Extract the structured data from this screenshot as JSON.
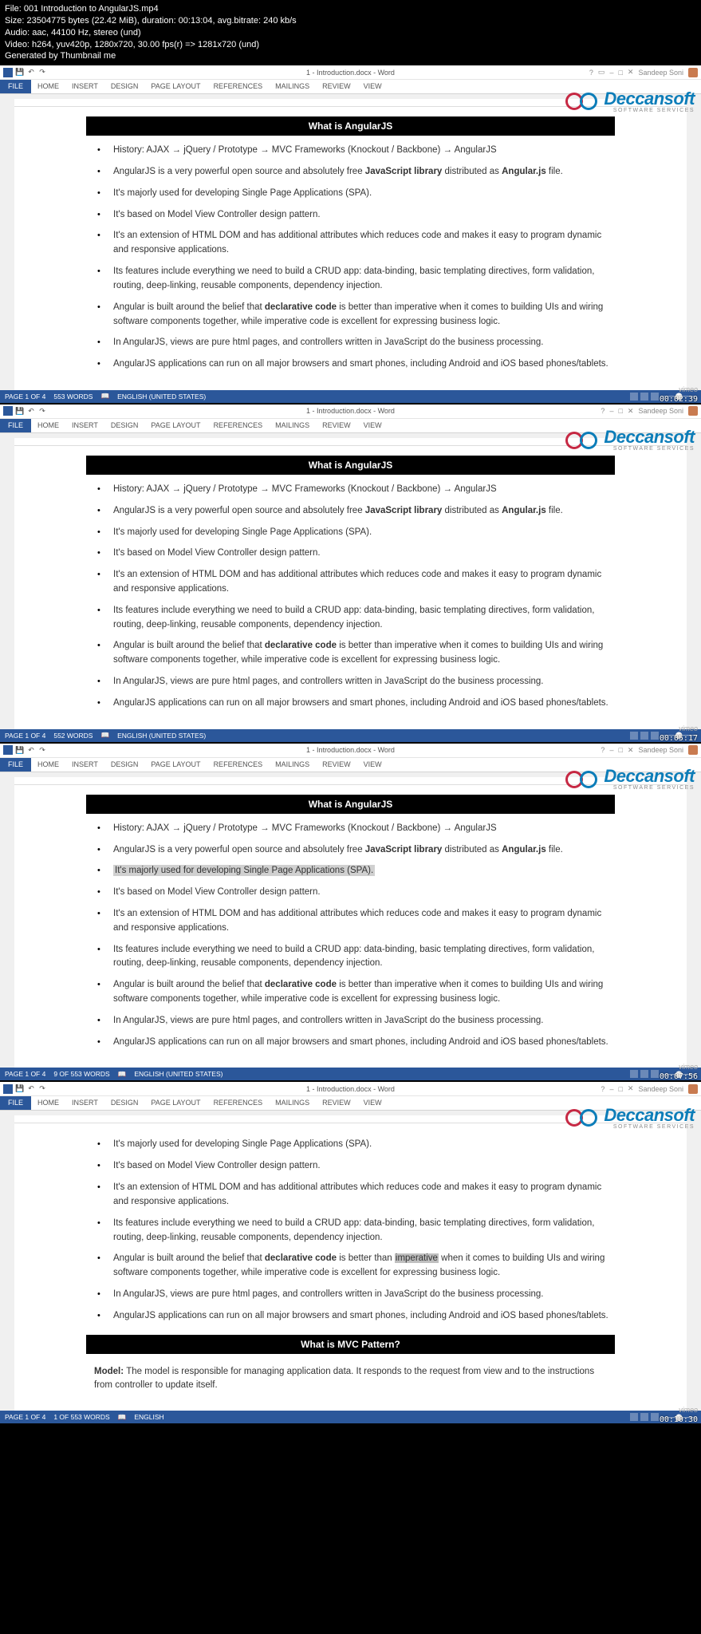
{
  "file_info": {
    "line1": "File: 001 Introduction to AngularJS.mp4",
    "line2": "Size: 23504775 bytes (22.42 MiB), duration: 00:13:04, avg.bitrate: 240 kb/s",
    "line3": "Audio: aac, 44100 Hz, stereo (und)",
    "line4": "Video: h264, yuv420p, 1280x720, 30.00 fps(r) => 1281x720 (und)",
    "line5": "Generated by Thumbnail me"
  },
  "word": {
    "title": "1 - Introduction.docx - Word",
    "user": "Sandeep Soni",
    "file_tab": "FILE",
    "tabs": [
      "HOME",
      "INSERT",
      "DESIGN",
      "PAGE LAYOUT",
      "REFERENCES",
      "MAILINGS",
      "REVIEW",
      "VIEW"
    ]
  },
  "watermark": {
    "main": "Deccansoft",
    "sub": "SOFTWARE SERVICES"
  },
  "content": {
    "heading1": "What is AngularJS",
    "heading2": "What is MVC Pattern?",
    "bullets": [
      {
        "pre": "History: AJAX ",
        "p2": " jQuery / Prototype ",
        "p3": " MVC Frameworks (Knockout / Backbone) ",
        "p4": " AngularJS"
      },
      {
        "pre": "AngularJS is a very powerful open source and absolutely free ",
        "b1": "JavaScript library",
        "mid": " distributed as ",
        "b2": "Angular.js",
        "post": " file."
      },
      {
        "text": "It's majorly used for developing Single Page Applications (SPA)."
      },
      {
        "text": "It's based on Model View Controller design pattern."
      },
      {
        "text": "It's an extension of HTML DOM and has additional attributes which reduces code and makes it easy to program dynamic and responsive applications."
      },
      {
        "text": "Its features include everything we need to build a CRUD app: data-binding, basic templating directives, form validation, routing, deep-linking, reusable components, dependency injection."
      },
      {
        "pre": "Angular is built around the belief that ",
        "b1": "declarative code",
        "post": " is better than imperative when it comes to building UIs and wiring software components together, while imperative code is excellent for expressing business logic."
      },
      {
        "text": "In AngularJS, views are pure html pages, and controllers written in JavaScript do the business processing."
      },
      {
        "text": "AngularJS applications can run on all major browsers and smart phones, including Android and iOS based phones/tablets."
      }
    ],
    "model_para_pre": "Model: ",
    "model_para": "The model is responsible for managing application data. It responds to the request from view and to the instructions from controller to update itself."
  },
  "status": {
    "f1": {
      "page": "PAGE 1 OF 4",
      "words": "553 WORDS",
      "lang": "ENGLISH (UNITED STATES)"
    },
    "f2": {
      "page": "PAGE 1 OF 4",
      "words": "552 WORDS",
      "lang": "ENGLISH (UNITED STATES)"
    },
    "f3": {
      "page": "PAGE 1 OF 4",
      "words": "9 OF 553 WORDS",
      "lang": "ENGLISH (UNITED STATES)"
    },
    "f4": {
      "page": "PAGE 1 OF 4",
      "words": "1 OF 553 WORDS",
      "lang": "ENGLISH"
    }
  },
  "timestamps": {
    "t1": "00:02:39",
    "t2": "00:05:17",
    "t3": "00:07:56",
    "t4": "00:10:30"
  },
  "vimeo": "vimeo"
}
